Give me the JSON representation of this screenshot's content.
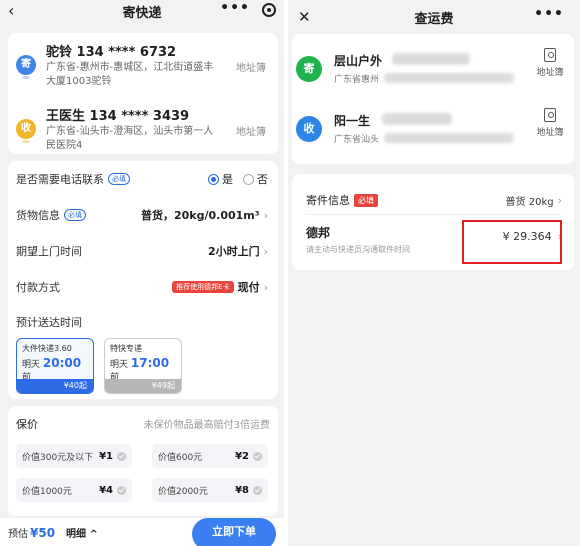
{
  "left": {
    "header": {
      "title": "寄快递",
      "more": "•••"
    },
    "sender": {
      "badge": "寄",
      "name": "驼铃  134 **** 6732",
      "address": "广东省-惠州市-惠城区，江北街道盛丰大厦1003驼铃",
      "book": "地址簿"
    },
    "receiver": {
      "badge": "收",
      "name": "王医生  134 **** 3439",
      "address": "广东省-汕头市-澄海区，汕头市第一人民医院4",
      "book": "地址簿"
    },
    "phone_contact": {
      "label": "是否需要电话联系",
      "tag": "必填",
      "yes": "是",
      "no": "否"
    },
    "cargo": {
      "label": "货物信息",
      "tag": "必填",
      "value": "普货，20kg/0.001m³"
    },
    "pickup": {
      "label": "期望上门时间",
      "value": "2小时上门"
    },
    "payment": {
      "label": "付款方式",
      "promo": "推荐使用德邦E卡",
      "value": "现付"
    },
    "eta_label": "预计送达时间",
    "services": [
      {
        "name": "大件快递3.60",
        "day": "明天",
        "time": "20:00",
        "suffix": "前",
        "price": "¥40起"
      },
      {
        "name": "特快专递",
        "day": "明天",
        "time": "17:00",
        "suffix": "前",
        "price": "¥49起"
      }
    ],
    "insurance": {
      "label": "保价",
      "note": "未保价物品最高赔付3倍运费",
      "options": [
        {
          "label": "价值300元及以下",
          "price": "¥1"
        },
        {
          "label": "价值600元",
          "price": "¥2"
        },
        {
          "label": "价值1000元",
          "price": "¥4"
        },
        {
          "label": "价值2000元",
          "price": "¥8"
        }
      ]
    },
    "footer": {
      "est_label": "预估",
      "est_price": "¥50",
      "detail": "明细 ^",
      "order": "立即下单"
    }
  },
  "right": {
    "header": {
      "title": "查运费",
      "more": "•••"
    },
    "sender": {
      "badge": "寄",
      "name": "层山户外",
      "address": "广东省惠州",
      "book": "地址簿"
    },
    "receiver": {
      "badge": "收",
      "name": "阳一生",
      "address": "广东省汕头",
      "book": "地址簿"
    },
    "cargo": {
      "label": "寄件信息",
      "tag": "必填",
      "value": "普货 20kg"
    },
    "carrier": {
      "name": "德邦",
      "hint": "请主动与快递员沟通取件时间",
      "price": "¥ 29.364"
    }
  },
  "colors": {
    "accent": "#2e6be6",
    "danger": "#e02020",
    "green": "#1fb34e"
  }
}
